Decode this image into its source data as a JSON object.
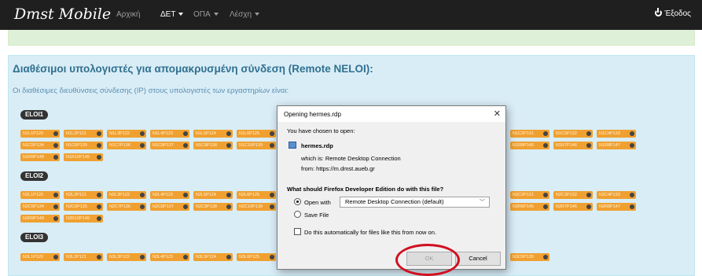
{
  "navbar": {
    "brand": "Dmst Mobile",
    "items": [
      {
        "label": "Αρχική"
      },
      {
        "label": "ΔΕΤ"
      },
      {
        "label": "ΟΠΑ"
      },
      {
        "label": "Λέσχη"
      }
    ],
    "logout": "Έξοδος"
  },
  "panel": {
    "title": "Διαθέσιμοι υπολογιστές για απομακρυσμένη σύνδεση (Remote NELOI):",
    "description": "Οι διαθέσιμες διευθύνσεις σύνδεσης (IP) στους υπολογιστές των εργαστηρίων είναι:"
  },
  "labs": [
    {
      "label": "ELOI1"
    },
    {
      "label": "ELOI2"
    },
    {
      "label": "ELOI3"
    }
  ],
  "chips": {
    "row1": [
      "N1L1P120",
      "N1L2P121",
      "N1L3P122",
      "N1L4P123",
      "N1L5P124",
      "N1L6P125",
      "N1C2P131",
      "N1C3P132",
      "N1C4P133"
    ],
    "row2": [
      "N1C5P134",
      "N1C6P135",
      "N1C7P136",
      "N1C8P137",
      "N1C9P138",
      "N1C10P139",
      "N1R8P145",
      "N1R7P146",
      "N1R8P147"
    ],
    "row3": [
      "N1R9P148",
      "N1R10P149"
    ],
    "row4": [
      "N2L1P120",
      "N2L2P121",
      "N2L3P122",
      "N2L4P123",
      "N2L5P124",
      "N2L6P125",
      "N2C2P131",
      "N2C3P132",
      "N2C4P133"
    ],
    "row5": [
      "N2C5P134",
      "N2C6P135",
      "N2C7P136",
      "N2C8P137",
      "N2C9P138",
      "N2C10P139",
      "N2R6P145",
      "N2R7P146",
      "N2R8P147"
    ],
    "row6": [
      "N2R9P148",
      "N2R10P149"
    ],
    "row7": [
      "N3L1P120",
      "N3L2P121",
      "N3L3P122",
      "N3L4P123",
      "N3L5P124",
      "N3L6P125",
      "N3C6P135"
    ]
  },
  "dialog": {
    "title": "Opening hermes.rdp",
    "chosen": "You have chosen to open:",
    "filename": "hermes.rdp",
    "which_is": "which is: Remote Desktop Connection",
    "from": "from: https://m.dmst.aueb.gr",
    "question": "What should Firefox Developer Edition do with this file?",
    "open_with_label": "Open with",
    "open_with_value": "Remote Desktop Connection (default)",
    "save_file_label": "Save File",
    "auto_label": "Do this automatically for files like this from now on.",
    "ok_label": "OK",
    "cancel_label": "Cancel"
  },
  "colors": {
    "navbar": "#1f1f1f",
    "panel": "#d9edf7",
    "chip": "#f0a030",
    "annotation": "#d01020"
  }
}
